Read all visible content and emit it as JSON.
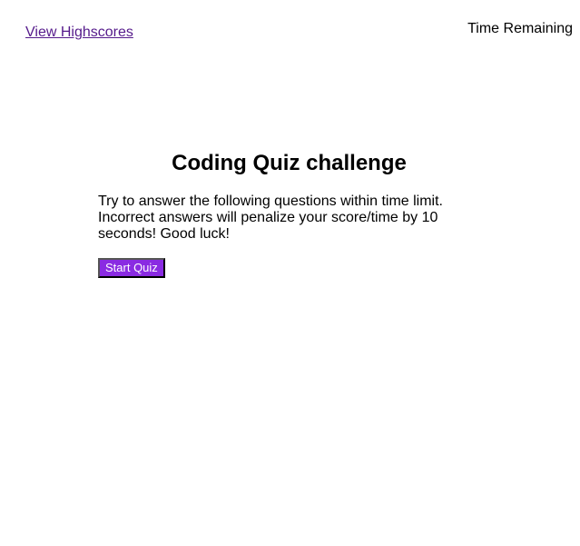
{
  "header": {
    "highscores_link": "View Highscores",
    "timer_label": "Time Remaining"
  },
  "main": {
    "title": "Coding Quiz challenge",
    "intro": "Try to answer the following questions within time limit. Incorrect answers will penalize your score/time by 10 seconds! Good luck!",
    "start_button": "Start Quiz"
  },
  "colors": {
    "link": "#551a8b",
    "button_bg": "#8a2be2",
    "button_text": "#ffffff"
  }
}
